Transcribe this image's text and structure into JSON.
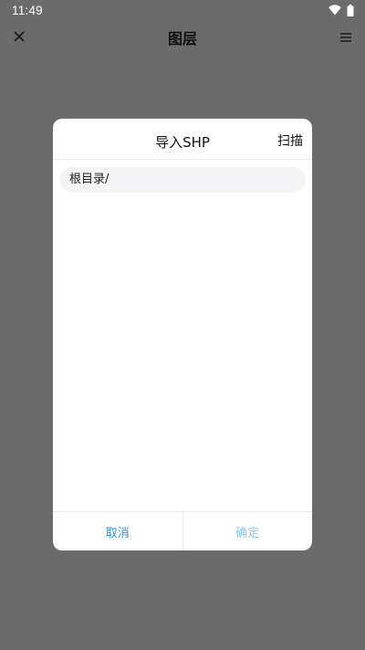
{
  "status_bar": {
    "time": "11:49",
    "icons": [
      "wifi-icon",
      "battery-icon"
    ]
  },
  "app_bar": {
    "title": "图层",
    "left_icon": "close-icon",
    "right_icon": "menu-icon"
  },
  "dialog": {
    "title": "导入SHP",
    "scan_label": "扫描",
    "path": "根目录/",
    "cancel_label": "取消",
    "confirm_label": "确定",
    "colors": {
      "cancel": "#2b8fd8",
      "confirm_disabled": "#8fc3ea",
      "overlay": "#6b6b6b"
    }
  }
}
